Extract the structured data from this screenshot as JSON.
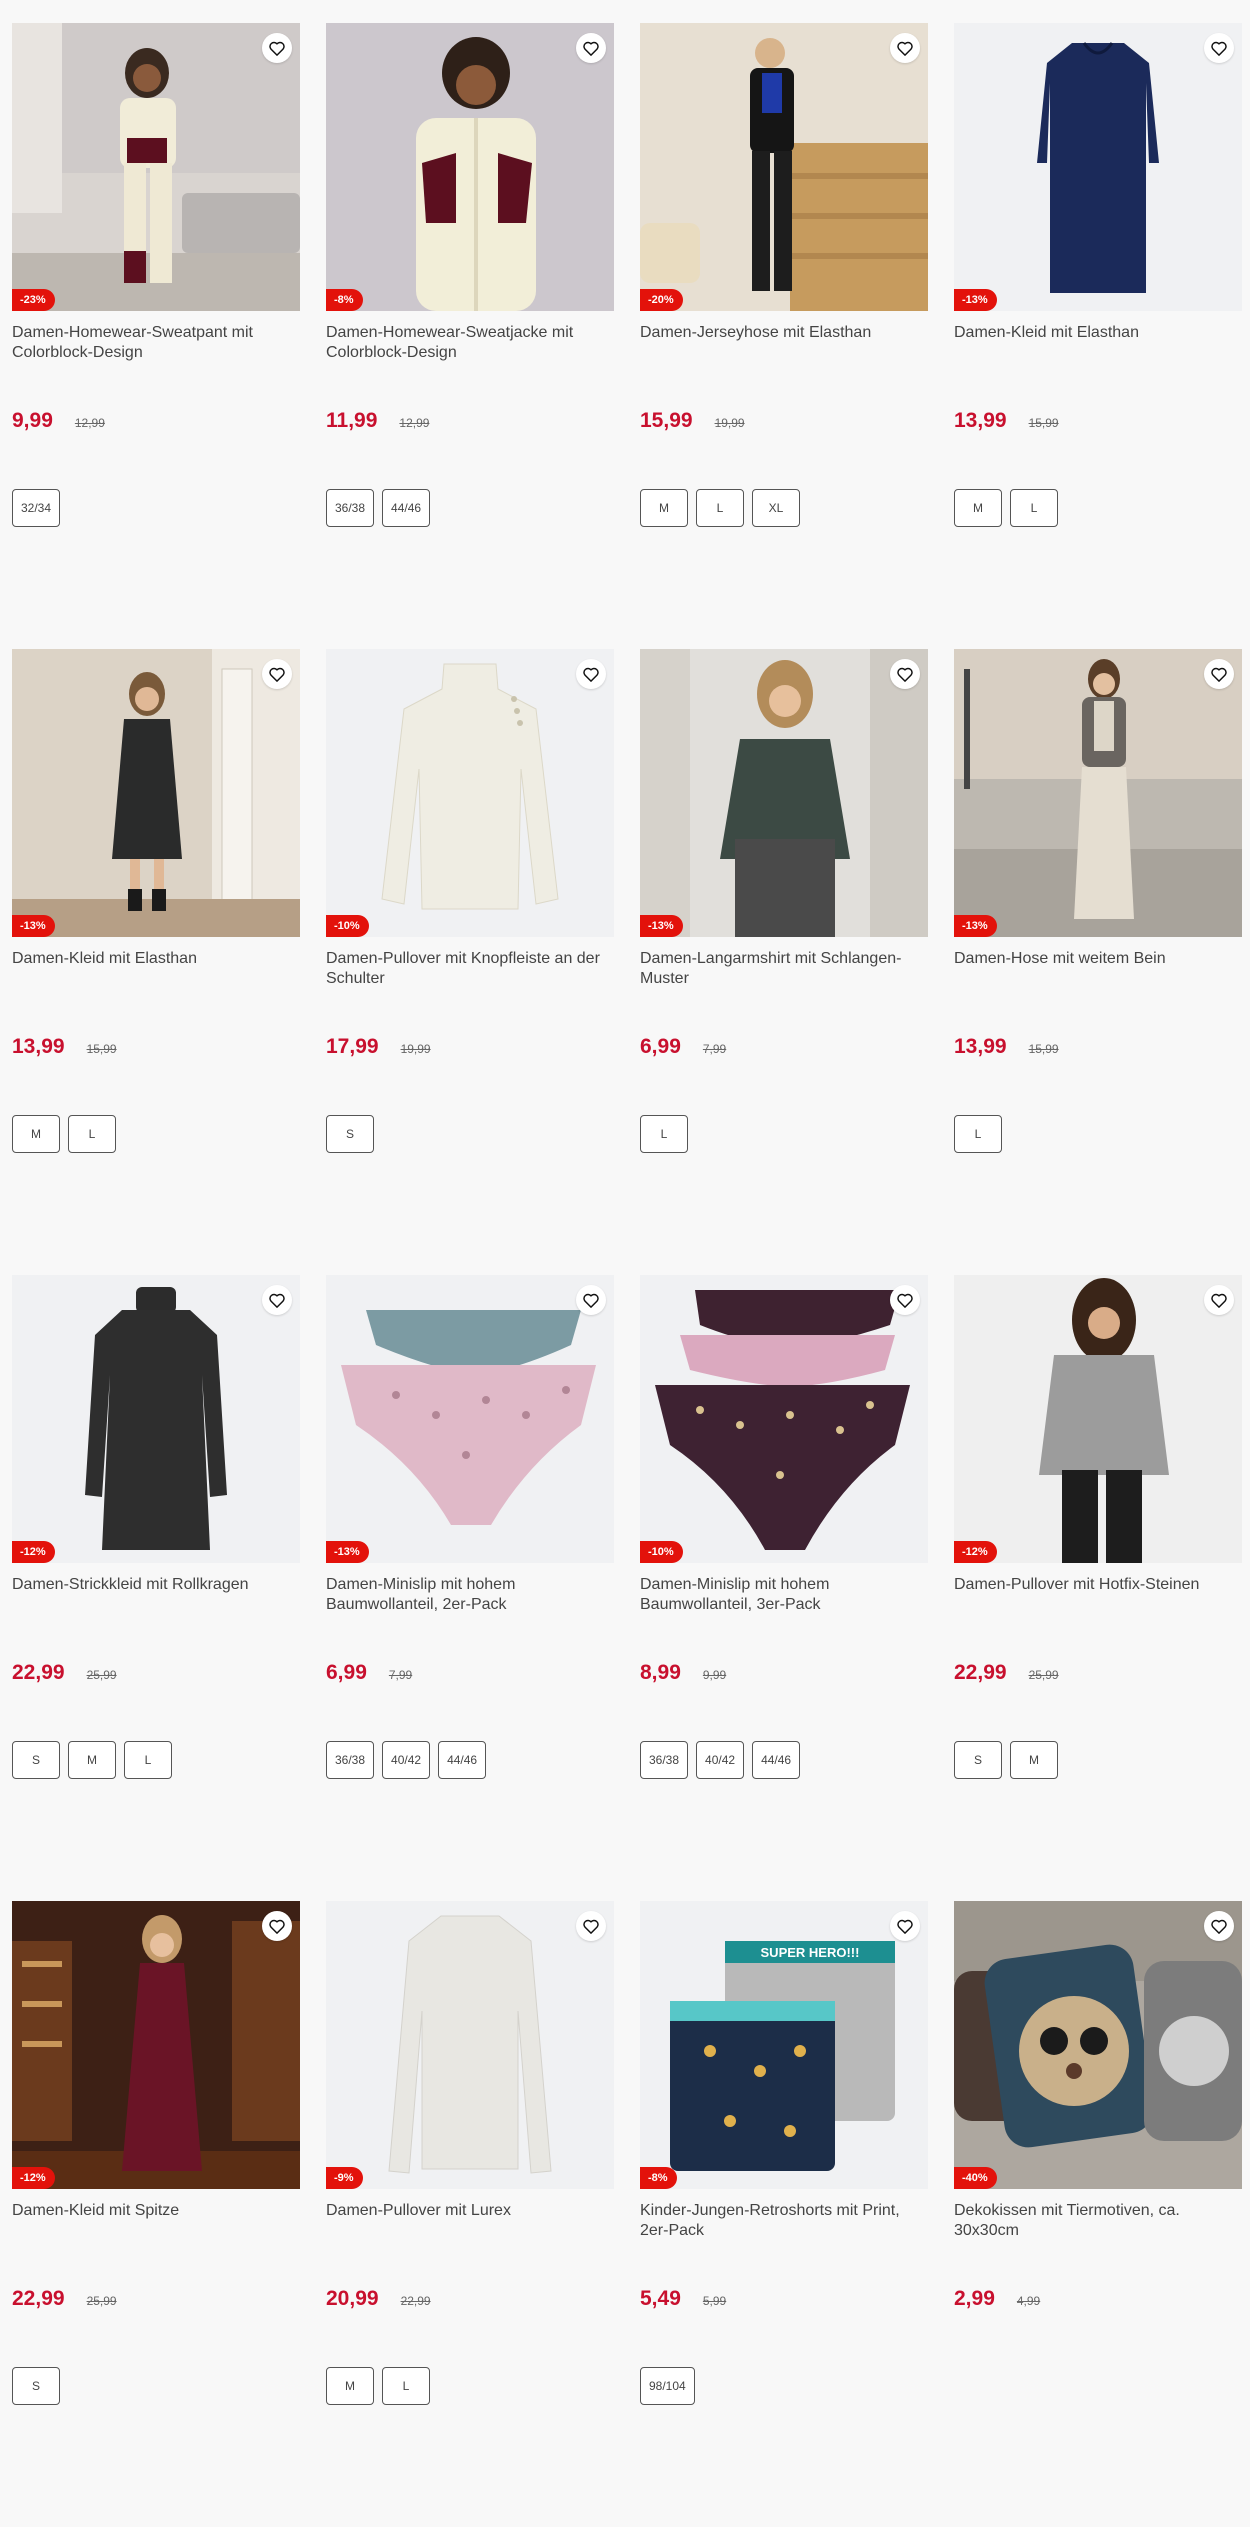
{
  "products": [
    {
      "name": "Damen-Homewear-Sweatpant mit Colorblock-Design",
      "discount": "-23%",
      "price": "9,99",
      "old_price": "12,99",
      "sizes": [
        "32/34"
      ],
      "image": "woman-cream-sweatpant",
      "favorite_icon": "heart-icon"
    },
    {
      "name": "Damen-Homewear-Sweatjacke mit Colorblock-Design",
      "discount": "-8%",
      "price": "11,99",
      "old_price": "12,99",
      "sizes": [
        "36/38",
        "44/46"
      ],
      "image": "woman-cream-sweatjacket",
      "favorite_icon": "heart-icon"
    },
    {
      "name": "Damen-Jerseyhose mit Elasthan",
      "discount": "-20%",
      "price": "15,99",
      "old_price": "19,99",
      "sizes": [
        "M",
        "L",
        "XL"
      ],
      "image": "woman-black-trousers-stairs",
      "favorite_icon": "heart-icon"
    },
    {
      "name": "Damen-Kleid mit Elasthan",
      "discount": "-13%",
      "price": "13,99",
      "old_price": "15,99",
      "sizes": [
        "M",
        "L"
      ],
      "image": "navy-dress",
      "favorite_icon": "heart-icon"
    },
    {
      "name": "Damen-Kleid mit Elasthan",
      "discount": "-13%",
      "price": "13,99",
      "old_price": "15,99",
      "sizes": [
        "M",
        "L"
      ],
      "image": "woman-dark-dress",
      "favorite_icon": "heart-icon"
    },
    {
      "name": "Damen-Pullover mit Knopfleiste an der Schulter",
      "discount": "-10%",
      "price": "17,99",
      "old_price": "19,99",
      "sizes": [
        "S"
      ],
      "image": "cream-pullover",
      "favorite_icon": "heart-icon"
    },
    {
      "name": "Damen-Langarmshirt mit Schlangen-Muster",
      "discount": "-13%",
      "price": "6,99",
      "old_price": "7,99",
      "sizes": [
        "L"
      ],
      "image": "woman-snake-shirt",
      "favorite_icon": "heart-icon"
    },
    {
      "name": "Damen-Hose mit weitem Bein",
      "discount": "-13%",
      "price": "13,99",
      "old_price": "15,99",
      "sizes": [
        "L"
      ],
      "image": "woman-wide-trousers",
      "favorite_icon": "heart-icon"
    },
    {
      "name": "Damen-Strickkleid mit Rollkragen",
      "discount": "-12%",
      "price": "22,99",
      "old_price": "25,99",
      "sizes": [
        "S",
        "M",
        "L"
      ],
      "image": "black-knit-dress",
      "favorite_icon": "heart-icon"
    },
    {
      "name": "Damen-Minislip mit hohem Baumwollanteil, 2er-Pack",
      "discount": "-13%",
      "price": "6,99",
      "old_price": "7,99",
      "sizes": [
        "36/38",
        "40/42",
        "44/46"
      ],
      "image": "briefs-2-pack",
      "favorite_icon": "heart-icon"
    },
    {
      "name": "Damen-Minislip mit hohem Baumwollanteil, 3er-Pack",
      "discount": "-10%",
      "price": "8,99",
      "old_price": "9,99",
      "sizes": [
        "36/38",
        "40/42",
        "44/46"
      ],
      "image": "briefs-3-pack",
      "favorite_icon": "heart-icon"
    },
    {
      "name": "Damen-Pullover mit Hotfix-Steinen",
      "discount": "-12%",
      "price": "22,99",
      "old_price": "25,99",
      "sizes": [
        "S",
        "M"
      ],
      "image": "woman-grey-pullover",
      "favorite_icon": "heart-icon"
    },
    {
      "name": "Damen-Kleid mit Spitze",
      "discount": "-12%",
      "price": "22,99",
      "old_price": "25,99",
      "sizes": [
        "S"
      ],
      "image": "woman-lace-dress",
      "favorite_icon": "heart-icon"
    },
    {
      "name": "Damen-Pullover mit Lurex",
      "discount": "-9%",
      "price": "20,99",
      "old_price": "22,99",
      "sizes": [
        "M",
        "L"
      ],
      "image": "white-lurex-pullover",
      "favorite_icon": "heart-icon"
    },
    {
      "name": "Kinder-Jungen-Retroshorts mit Print, 2er-Pack",
      "discount": "-8%",
      "price": "5,49",
      "old_price": "5,99",
      "sizes": [
        "98/104"
      ],
      "image": "boys-retroshorts",
      "image_text": "SUPER HERO!!!",
      "favorite_icon": "heart-icon"
    },
    {
      "name": "Dekokissen mit Tiermotiven, ca. 30x30cm",
      "discount": "-40%",
      "price": "2,99",
      "old_price": "4,99",
      "sizes": [],
      "image": "animal-cushions",
      "favorite_icon": "heart-icon"
    }
  ],
  "colors": {
    "price_red": "#c8102e",
    "badge_red": "#e3120b",
    "background": "#f8f8f8"
  }
}
